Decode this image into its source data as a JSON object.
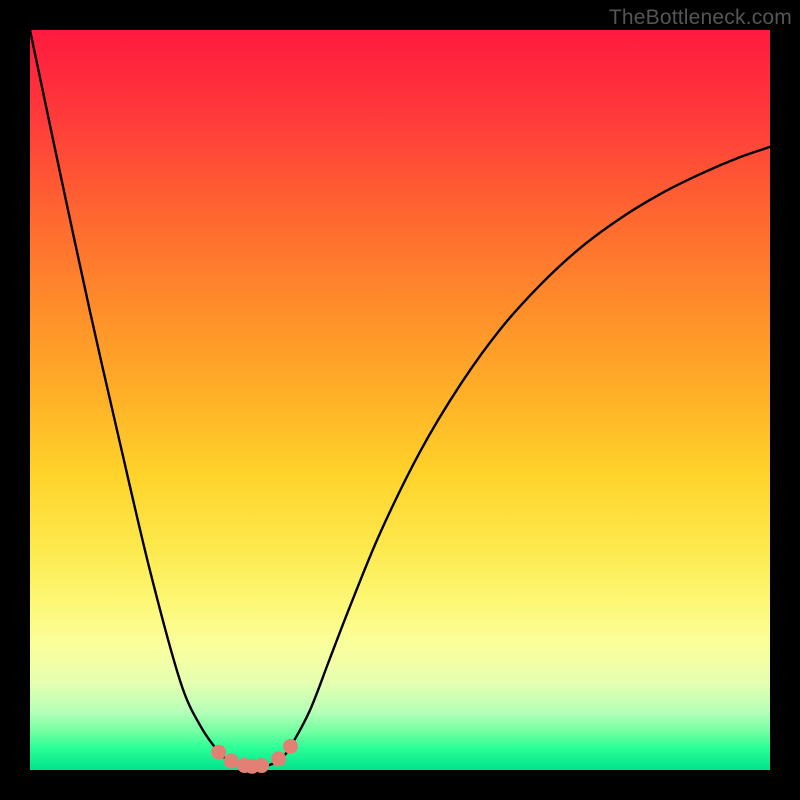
{
  "watermark": "TheBottleneck.com",
  "colors": {
    "frame": "#000000",
    "curve": "#000000",
    "marker_fill": "#e38074",
    "marker_stroke": "#e38074"
  },
  "chart_data": {
    "type": "line",
    "title": "",
    "xlabel": "",
    "ylabel": "",
    "xlim": [
      0,
      1
    ],
    "ylim": [
      0,
      100
    ],
    "series": [
      {
        "name": "bottleneck-curve",
        "x": [
          0.0,
          0.04,
          0.081,
          0.122,
          0.162,
          0.203,
          0.23,
          0.257,
          0.27,
          0.284,
          0.297,
          0.311,
          0.324,
          0.338,
          0.351,
          0.378,
          0.405,
          0.432,
          0.473,
          0.527,
          0.581,
          0.635,
          0.689,
          0.743,
          0.797,
          0.851,
          0.905,
          0.959,
          1.0
        ],
        "y": [
          100.0,
          81.0,
          62.0,
          44.0,
          27.0,
          12.0,
          6.0,
          2.2,
          1.3,
          0.7,
          0.4,
          0.4,
          0.7,
          1.4,
          3.0,
          8.0,
          15.0,
          22.0,
          32.0,
          43.0,
          52.0,
          59.5,
          65.5,
          70.5,
          74.5,
          77.8,
          80.5,
          82.8,
          84.2
        ]
      }
    ],
    "markers": {
      "name": "highlighted-points",
      "x": [
        0.255,
        0.272,
        0.29,
        0.3,
        0.313,
        0.336,
        0.352
      ],
      "y": [
        2.4,
        1.2,
        0.6,
        0.5,
        0.6,
        1.5,
        3.2
      ]
    }
  }
}
